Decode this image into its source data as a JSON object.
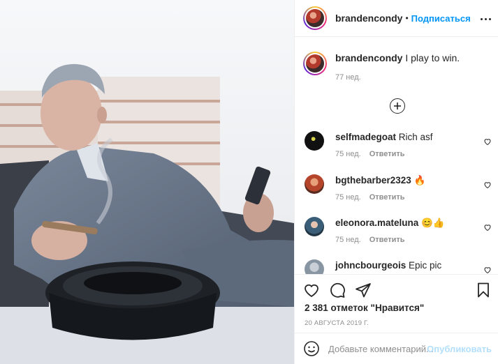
{
  "post": {
    "author": "brandencondy",
    "dot": "•",
    "follow_label": "Подписаться",
    "caption_text": "I play to win.",
    "caption_time": "77 нед.",
    "likes": "2 381 отметок \"Нравится\"",
    "date": "20 АВГУСТА 2019 Г."
  },
  "comments": [
    {
      "user": "selfmadegoat",
      "text": "Rich asf",
      "time": "75 нед.",
      "reply": "Ответить",
      "avatar_color": "#1a1a1a"
    },
    {
      "user": "bgthebarber2323",
      "text": "🔥",
      "time": "75 нед.",
      "reply": "Ответить",
      "avatar_color": "#c0582e"
    },
    {
      "user": "eleonora.mateluna",
      "text": "😊👍",
      "time": "75 нед.",
      "reply": "Ответить",
      "avatar_color": "#3b5e78"
    },
    {
      "user": "johncbourgeois",
      "text": "Epic pic",
      "time": "",
      "reply": "",
      "avatar_color": "#8896a4"
    }
  ],
  "add_comment": {
    "placeholder": "Добавьте комментарий...",
    "publish_label": "Опубликовать"
  },
  "icons": {
    "more": "more-options-icon",
    "load_more": "plus-circle-icon",
    "like": "heart-icon",
    "comment": "comment-icon",
    "share": "paper-plane-icon",
    "save": "bookmark-icon",
    "emoji": "smiley-icon"
  },
  "colors": {
    "accent": "#0095f6",
    "publish_disabled": "#b2dffc",
    "muted": "#8e8e8e"
  }
}
